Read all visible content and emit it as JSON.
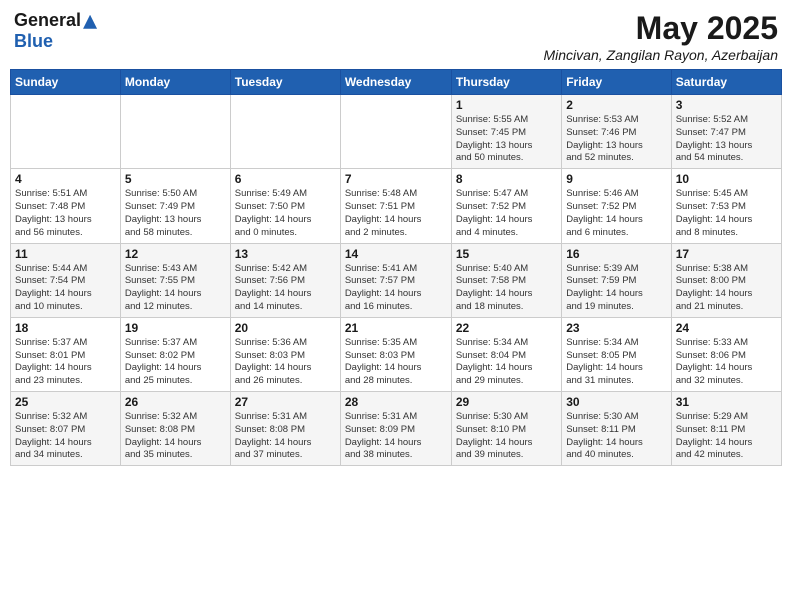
{
  "header": {
    "logo_general": "General",
    "logo_blue": "Blue",
    "title": "May 2025",
    "subtitle": "Mincivan, Zangilan Rayon, Azerbaijan"
  },
  "weekdays": [
    "Sunday",
    "Monday",
    "Tuesday",
    "Wednesday",
    "Thursday",
    "Friday",
    "Saturday"
  ],
  "weeks": [
    [
      {
        "num": "",
        "info": ""
      },
      {
        "num": "",
        "info": ""
      },
      {
        "num": "",
        "info": ""
      },
      {
        "num": "",
        "info": ""
      },
      {
        "num": "1",
        "info": "Sunrise: 5:55 AM\nSunset: 7:45 PM\nDaylight: 13 hours\nand 50 minutes."
      },
      {
        "num": "2",
        "info": "Sunrise: 5:53 AM\nSunset: 7:46 PM\nDaylight: 13 hours\nand 52 minutes."
      },
      {
        "num": "3",
        "info": "Sunrise: 5:52 AM\nSunset: 7:47 PM\nDaylight: 13 hours\nand 54 minutes."
      }
    ],
    [
      {
        "num": "4",
        "info": "Sunrise: 5:51 AM\nSunset: 7:48 PM\nDaylight: 13 hours\nand 56 minutes."
      },
      {
        "num": "5",
        "info": "Sunrise: 5:50 AM\nSunset: 7:49 PM\nDaylight: 13 hours\nand 58 minutes."
      },
      {
        "num": "6",
        "info": "Sunrise: 5:49 AM\nSunset: 7:50 PM\nDaylight: 14 hours\nand 0 minutes."
      },
      {
        "num": "7",
        "info": "Sunrise: 5:48 AM\nSunset: 7:51 PM\nDaylight: 14 hours\nand 2 minutes."
      },
      {
        "num": "8",
        "info": "Sunrise: 5:47 AM\nSunset: 7:52 PM\nDaylight: 14 hours\nand 4 minutes."
      },
      {
        "num": "9",
        "info": "Sunrise: 5:46 AM\nSunset: 7:52 PM\nDaylight: 14 hours\nand 6 minutes."
      },
      {
        "num": "10",
        "info": "Sunrise: 5:45 AM\nSunset: 7:53 PM\nDaylight: 14 hours\nand 8 minutes."
      }
    ],
    [
      {
        "num": "11",
        "info": "Sunrise: 5:44 AM\nSunset: 7:54 PM\nDaylight: 14 hours\nand 10 minutes."
      },
      {
        "num": "12",
        "info": "Sunrise: 5:43 AM\nSunset: 7:55 PM\nDaylight: 14 hours\nand 12 minutes."
      },
      {
        "num": "13",
        "info": "Sunrise: 5:42 AM\nSunset: 7:56 PM\nDaylight: 14 hours\nand 14 minutes."
      },
      {
        "num": "14",
        "info": "Sunrise: 5:41 AM\nSunset: 7:57 PM\nDaylight: 14 hours\nand 16 minutes."
      },
      {
        "num": "15",
        "info": "Sunrise: 5:40 AM\nSunset: 7:58 PM\nDaylight: 14 hours\nand 18 minutes."
      },
      {
        "num": "16",
        "info": "Sunrise: 5:39 AM\nSunset: 7:59 PM\nDaylight: 14 hours\nand 19 minutes."
      },
      {
        "num": "17",
        "info": "Sunrise: 5:38 AM\nSunset: 8:00 PM\nDaylight: 14 hours\nand 21 minutes."
      }
    ],
    [
      {
        "num": "18",
        "info": "Sunrise: 5:37 AM\nSunset: 8:01 PM\nDaylight: 14 hours\nand 23 minutes."
      },
      {
        "num": "19",
        "info": "Sunrise: 5:37 AM\nSunset: 8:02 PM\nDaylight: 14 hours\nand 25 minutes."
      },
      {
        "num": "20",
        "info": "Sunrise: 5:36 AM\nSunset: 8:03 PM\nDaylight: 14 hours\nand 26 minutes."
      },
      {
        "num": "21",
        "info": "Sunrise: 5:35 AM\nSunset: 8:03 PM\nDaylight: 14 hours\nand 28 minutes."
      },
      {
        "num": "22",
        "info": "Sunrise: 5:34 AM\nSunset: 8:04 PM\nDaylight: 14 hours\nand 29 minutes."
      },
      {
        "num": "23",
        "info": "Sunrise: 5:34 AM\nSunset: 8:05 PM\nDaylight: 14 hours\nand 31 minutes."
      },
      {
        "num": "24",
        "info": "Sunrise: 5:33 AM\nSunset: 8:06 PM\nDaylight: 14 hours\nand 32 minutes."
      }
    ],
    [
      {
        "num": "25",
        "info": "Sunrise: 5:32 AM\nSunset: 8:07 PM\nDaylight: 14 hours\nand 34 minutes."
      },
      {
        "num": "26",
        "info": "Sunrise: 5:32 AM\nSunset: 8:08 PM\nDaylight: 14 hours\nand 35 minutes."
      },
      {
        "num": "27",
        "info": "Sunrise: 5:31 AM\nSunset: 8:08 PM\nDaylight: 14 hours\nand 37 minutes."
      },
      {
        "num": "28",
        "info": "Sunrise: 5:31 AM\nSunset: 8:09 PM\nDaylight: 14 hours\nand 38 minutes."
      },
      {
        "num": "29",
        "info": "Sunrise: 5:30 AM\nSunset: 8:10 PM\nDaylight: 14 hours\nand 39 minutes."
      },
      {
        "num": "30",
        "info": "Sunrise: 5:30 AM\nSunset: 8:11 PM\nDaylight: 14 hours\nand 40 minutes."
      },
      {
        "num": "31",
        "info": "Sunrise: 5:29 AM\nSunset: 8:11 PM\nDaylight: 14 hours\nand 42 minutes."
      }
    ]
  ]
}
